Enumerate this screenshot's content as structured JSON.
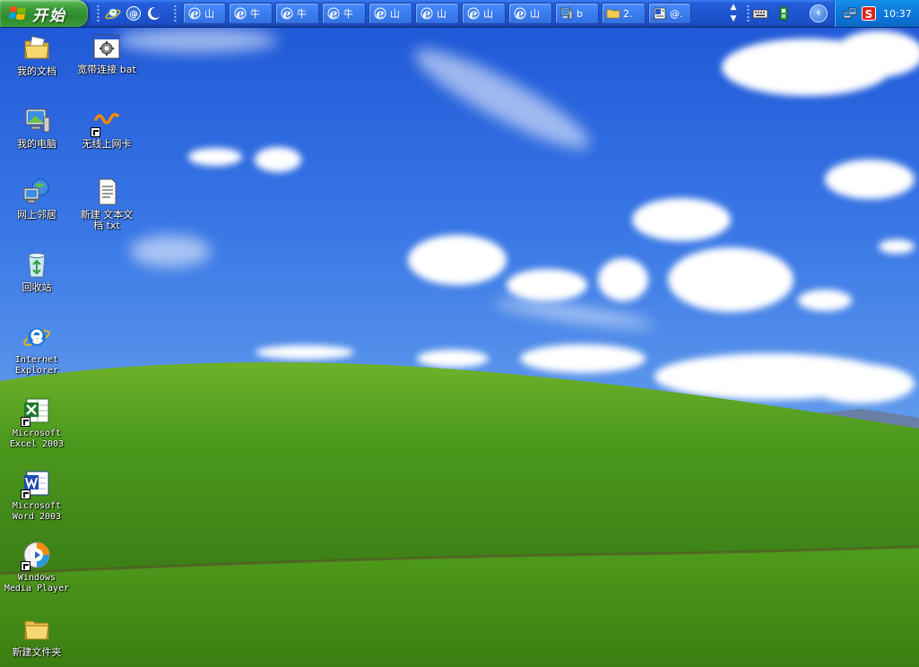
{
  "taskbar": {
    "start_label": "开始",
    "quick_launch": [
      {
        "icon": "ie-icon"
      },
      {
        "icon": "outlook-express-icon"
      },
      {
        "icon": "show-desktop-icon"
      }
    ],
    "task_buttons": [
      {
        "icon": "ie-icon",
        "label": "山"
      },
      {
        "icon": "ie-icon",
        "label": "牛"
      },
      {
        "icon": "ie-icon",
        "label": "牛"
      },
      {
        "icon": "ie-icon",
        "label": "牛"
      },
      {
        "icon": "ie-icon",
        "label": "山"
      },
      {
        "icon": "ie-icon",
        "label": "山"
      },
      {
        "icon": "ie-icon",
        "label": "山"
      },
      {
        "icon": "ie-icon",
        "label": "山"
      },
      {
        "icon": "computer-icon",
        "label": "b"
      },
      {
        "icon": "folder-icon",
        "label": "2."
      },
      {
        "icon": "document-icon",
        "label": "@."
      }
    ],
    "clock": "10:37"
  },
  "desktop": {
    "icons": [
      {
        "name": "my-documents-icon",
        "label": "我的文档",
        "shortcut": false
      },
      {
        "name": "broadband-bat-icon",
        "label": "宽带连接 bat",
        "shortcut": false
      },
      {
        "name": "my-computer-icon",
        "label": "我的电脑",
        "shortcut": false
      },
      {
        "name": "wireless-card-icon",
        "label": "无线上网卡",
        "shortcut": true
      },
      {
        "name": "network-places-icon",
        "label": "网上邻居",
        "shortcut": false
      },
      {
        "name": "new-text-document-icon",
        "label": "新建 文本文\n档 txt",
        "shortcut": false
      },
      {
        "name": "recycle-bin-icon",
        "label": "回收站",
        "shortcut": false
      },
      {
        "name": "internet-explorer-icon",
        "label": "Internet\nExplorer",
        "shortcut": false
      },
      {
        "name": "excel-icon",
        "label": "Microsoft\nExcel 2003",
        "shortcut": true
      },
      {
        "name": "word-icon",
        "label": "Microsoft\nWord 2003",
        "shortcut": true
      },
      {
        "name": "media-player-icon",
        "label": "Windows\nMedia Player",
        "shortcut": true
      },
      {
        "name": "new-folder-icon",
        "label": "新建文件夹",
        "shortcut": false
      }
    ]
  },
  "colors": {
    "taskbar_blue": "#245edb",
    "start_green": "#3d9d3a",
    "tray_blue": "#0f7fe0",
    "sky_blue": "#2a66d8",
    "grass_green": "#4f9a1e"
  }
}
